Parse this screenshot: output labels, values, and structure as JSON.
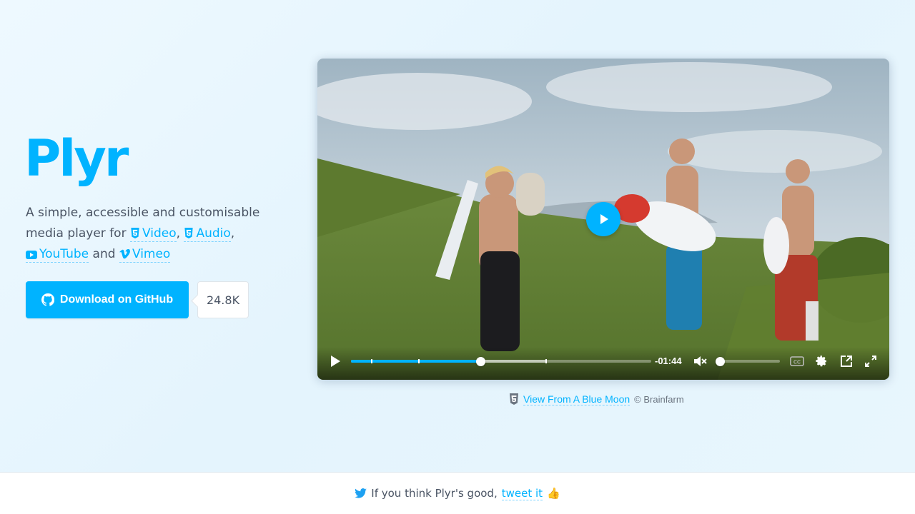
{
  "brand": {
    "title": "Plyr"
  },
  "tagline": {
    "line1": "A simple, accessible and customisable",
    "line2_prefix": "media player for",
    "video_link": "Video",
    "audio_link": "Audio",
    "youtube_link": "YouTube",
    "and_text": "and",
    "vimeo_link": "Vimeo",
    "comma": ","
  },
  "github": {
    "button_label": "Download on GitHub",
    "star_count": "24.8K"
  },
  "player": {
    "time_remaining": "-01:44",
    "progress_fraction": 0.43,
    "buffered_fraction": 0.65,
    "volume_fraction": 0,
    "muted": true,
    "icons": {
      "big_play": "play-icon",
      "play": "play-icon",
      "mute": "muted-volume-icon",
      "captions": "captions-icon",
      "settings": "gear-icon",
      "pip": "picture-in-picture-icon",
      "fullscreen": "fullscreen-icon"
    }
  },
  "caption": {
    "link_text": "View From A Blue Moon",
    "credit": "© Brainfarm"
  },
  "footer": {
    "prefix": "If you think Plyr's good,",
    "link_text": "tweet it",
    "emoji": "👍"
  },
  "colors": {
    "accent": "#00b3ff",
    "text": "#4a5464",
    "background": "#eaf7fe"
  }
}
